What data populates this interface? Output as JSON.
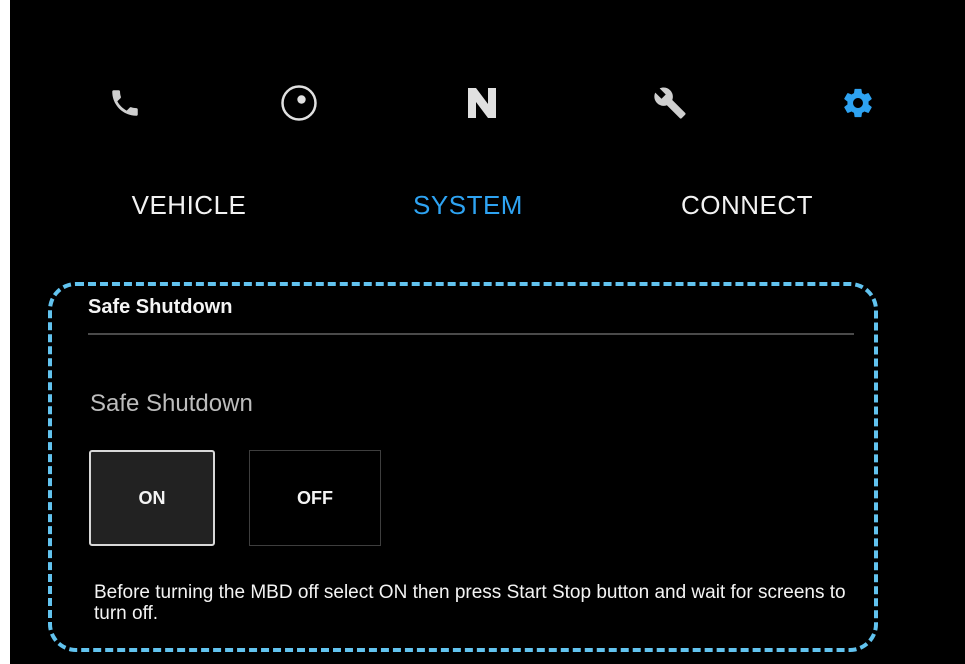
{
  "top_icons": [
    {
      "name": "phone-icon",
      "color": "#cfcfcf"
    },
    {
      "name": "navigation-ring-icon",
      "color": "#e0e0e0"
    },
    {
      "name": "n-logo-icon",
      "color": "#e0e0e0"
    },
    {
      "name": "wrench-icon",
      "color": "#cfcfcf"
    },
    {
      "name": "gear-icon",
      "color": "#2ea3f2",
      "active": true
    }
  ],
  "tabs": [
    {
      "label": "VEHICLE",
      "active": false
    },
    {
      "label": "SYSTEM",
      "active": true
    },
    {
      "label": "CONNECT",
      "active": false
    }
  ],
  "section": {
    "title": "Safe Shutdown",
    "setting_label": "Safe Shutdown",
    "options": {
      "on": "ON",
      "off": "OFF"
    },
    "selected": "ON",
    "hint": "Before turning the MBD off select ON then press Start Stop button and wait for screens to turn off."
  },
  "colors": {
    "accent": "#2ea3f2",
    "highlight_border": "#62c3ef",
    "background": "#000000"
  }
}
